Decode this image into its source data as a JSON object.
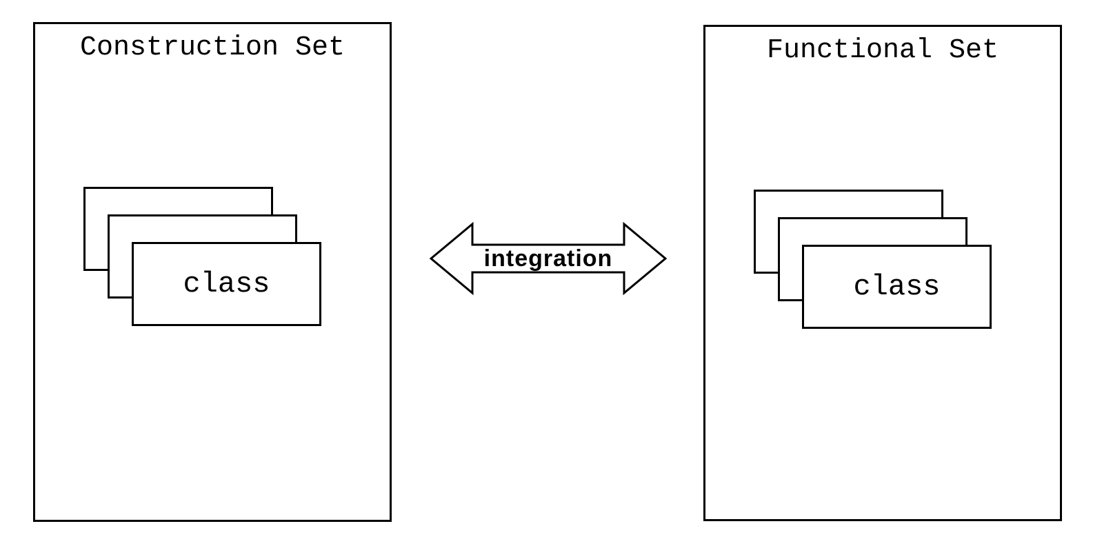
{
  "left_box": {
    "title": "Construction Set",
    "card_label": "class"
  },
  "right_box": {
    "title": "Functional Set",
    "card_label": "class"
  },
  "arrow": {
    "label": "integration"
  }
}
